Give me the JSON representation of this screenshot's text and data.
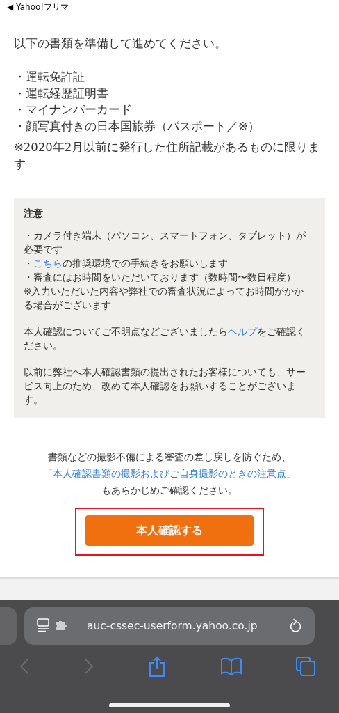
{
  "status_bar": {
    "back_app": "◀ Yahoo!フリマ"
  },
  "page": {
    "intro": "以下の書類を準備して進めてください。",
    "documents": [
      "・運転免許証",
      "・運転経歴証明書",
      "・マイナンバーカード",
      "・顔写真付きの日本国旅券（パスポート／※）"
    ],
    "footnote": "※2020年2月以前に発行した住所記載があるものに限ります",
    "notice": {
      "heading": "注意",
      "blocks": [
        [
          [
            {
              "text": "・カメラ付き端末（パソコン、スマートフォン、タブレット）が必要です",
              "kind": "text"
            }
          ],
          [
            {
              "text": "・",
              "kind": "text"
            },
            {
              "text": "こちら",
              "kind": "link"
            },
            {
              "text": "の推奨環境での手続きをお願いします",
              "kind": "text"
            }
          ],
          [
            {
              "text": "・審査にはお時間をいただいております（数時間〜数日程度）",
              "kind": "text"
            }
          ],
          [
            {
              "text": "※入力いただいた内容や弊社での審査状況によってお時間がかかる場合がございます",
              "kind": "text"
            }
          ]
        ],
        [
          [
            {
              "text": "本人確認についてご不明点などございましたら",
              "kind": "text"
            },
            {
              "text": "ヘルプ",
              "kind": "link"
            },
            {
              "text": "をご確認ください。",
              "kind": "text"
            }
          ]
        ],
        [
          [
            {
              "text": "以前に弊社へ本人確認書類の提出されたお客様についても、サービス向上のため、改めて本人確認をお願いすることがございます。",
              "kind": "text"
            }
          ]
        ]
      ]
    },
    "guide": [
      [
        {
          "text": "書類などの撮影不備による審査の差し戻しを防ぐため、",
          "kind": "text"
        }
      ],
      [
        {
          "text": "「",
          "kind": "text"
        },
        {
          "text": "本人確認書類の撮影およびご自身撮影のときの注意点",
          "kind": "link"
        },
        {
          "text": "」",
          "kind": "text"
        }
      ],
      [
        {
          "text": "もあらかじめご確認ください。",
          "kind": "text"
        }
      ]
    ],
    "button": {
      "label": "本人確認する",
      "highlighted": true
    }
  },
  "browser": {
    "url": "auc-cssec-userform.yahoo.co.jp",
    "back_disabled": true,
    "forward_disabled": true
  }
}
